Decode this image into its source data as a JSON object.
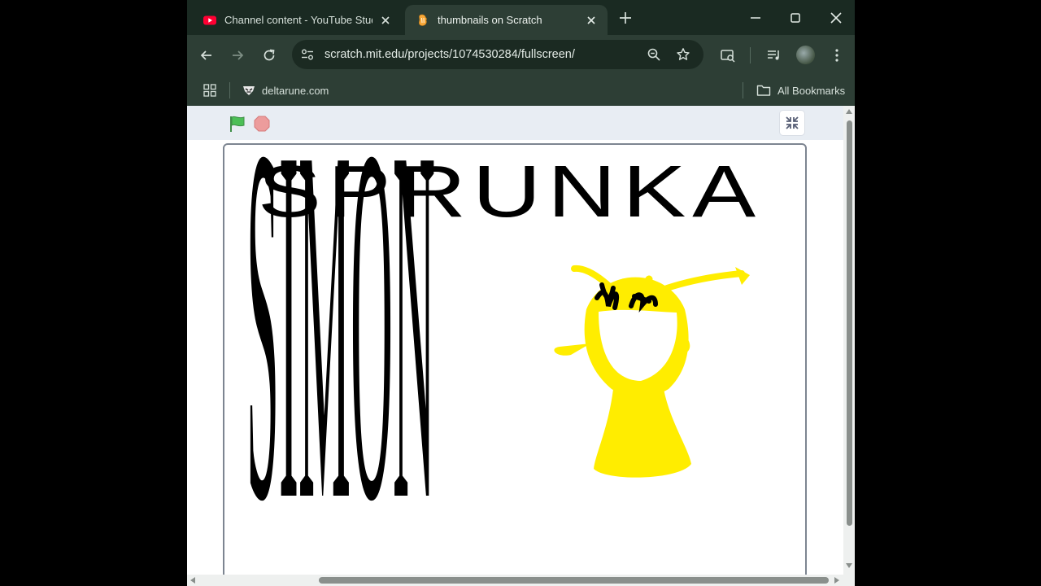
{
  "browser": {
    "tabs": [
      {
        "title": "Channel content - YouTube Studio",
        "active": false,
        "favicon": "youtube-icon"
      },
      {
        "title": "thumbnails on Scratch",
        "active": true,
        "favicon": "scratch-icon"
      }
    ],
    "url": "scratch.mit.edu/projects/1074530284/fullscreen/",
    "bookmarks": [
      {
        "label": "deltarune.com",
        "icon": "deltarune-icon"
      }
    ],
    "all_bookmarks_label": "All Bookmarks"
  },
  "stage": {
    "title_text": "SPRUNKA",
    "side_text": "SIMON",
    "character_color": "#ffed00"
  },
  "colors": {
    "tabstrip": "#1a2a22",
    "toolbar": "#2d3e35",
    "scratch_bar": "#e8edf3",
    "flag": "#4cbf56",
    "stop": "#ec9c9c"
  }
}
